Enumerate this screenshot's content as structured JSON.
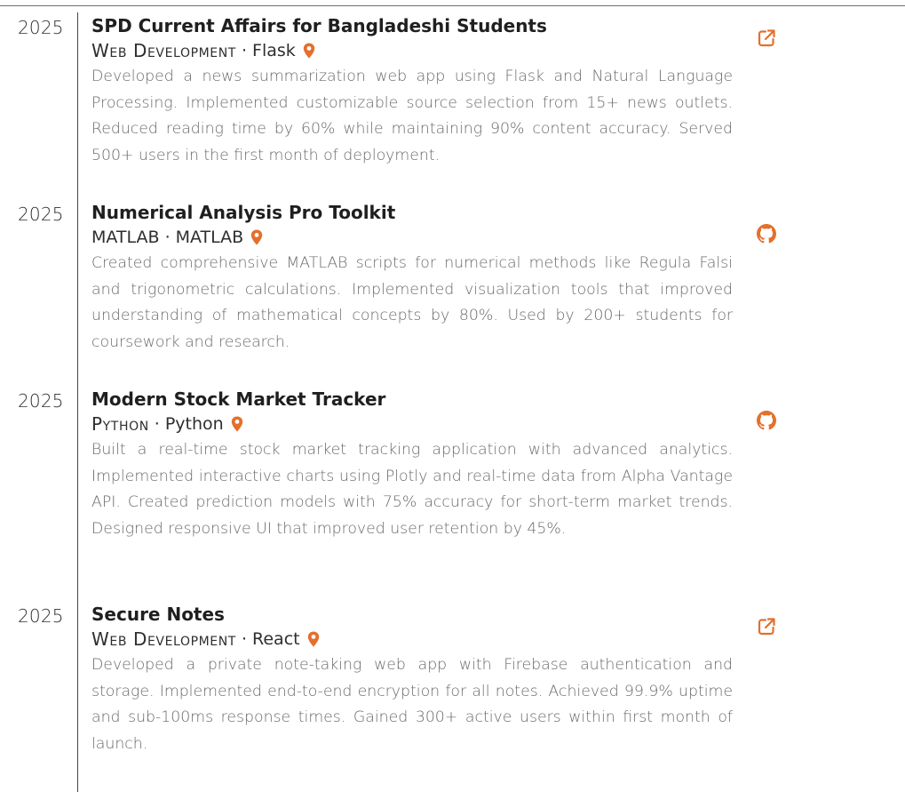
{
  "colors": {
    "accent": "#e4702c",
    "text": "#2b2b2b",
    "muted": "#6a6a6a",
    "rule": "#444444"
  },
  "entries": [
    {
      "year": "2025",
      "title": "SPD Current Affairs for Bangladeshi Students",
      "category": "Web Development",
      "location": "Flask",
      "location_icon": "map-marker-icon",
      "description": "Developed a news summarization web app using Flask and Natural Language Processing. Implemented customizable source selection from 15+ news outlets. Reduced reading time by 60% while maintaining 90% content accuracy. Served 500+ users in the first month of deployment.",
      "link_icon": "external-link-icon"
    },
    {
      "year": "2025",
      "title": "Numerical Analysis Pro Toolkit",
      "category": "MATLAB",
      "location": "MATLAB",
      "location_icon": "map-marker-icon",
      "description": "Created comprehensive MATLAB scripts for numerical methods like Regula Falsi and trigonometric calculations. Implemented visualization tools that improved understanding of mathematical concepts by 80%. Used by 200+ students for coursework and research.",
      "link_icon": "github-icon"
    },
    {
      "year": "2025",
      "title": "Modern Stock Market Tracker",
      "category": "Python",
      "location": "Python",
      "location_icon": "map-marker-icon",
      "description": "Built a real-time stock market tracking application with advanced analytics. Implemented interactive charts using Plotly and real-time data from Alpha Vantage API. Created prediction models with 75% accuracy for short-term market trends. Designed responsive UI that improved user retention by 45%.",
      "link_icon": "github-icon"
    },
    {
      "year": "2025",
      "title": "Secure Notes",
      "category": "Web Development",
      "location": "React",
      "location_icon": "map-marker-icon",
      "description": "Developed a private note-taking web app with Firebase authentication and storage. Implemented end-to-end encryption for all notes. Achieved 99.9% uptime and sub-100ms response times. Gained 300+ active users within first month of launch.",
      "link_icon": "external-link-icon"
    }
  ]
}
